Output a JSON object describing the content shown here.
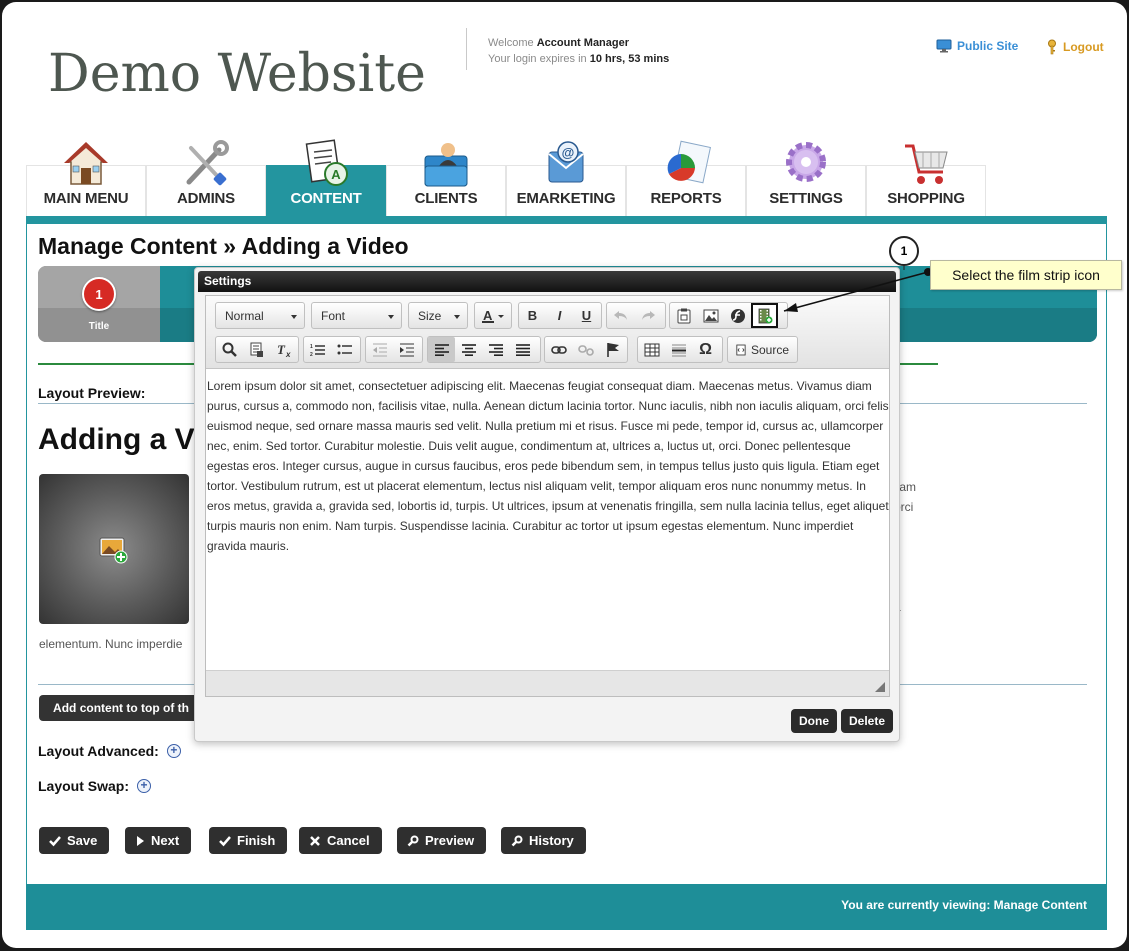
{
  "header": {
    "site_title": "Demo Website",
    "welcome_prefix": "Welcome",
    "user_name": "Account Manager",
    "login_prefix": "Your login expires in",
    "login_time": "10 hrs, 53 mins",
    "public_site": "Public Site",
    "logout": "Logout"
  },
  "nav": {
    "items": [
      {
        "label": "MAIN MENU",
        "icon": "house-icon"
      },
      {
        "label": "ADMINS",
        "icon": "tools-icon"
      },
      {
        "label": "CONTENT",
        "icon": "document-edit-icon",
        "active": true
      },
      {
        "label": "CLIENTS",
        "icon": "client-folder-icon"
      },
      {
        "label": "EMARKETING",
        "icon": "email-icon"
      },
      {
        "label": "REPORTS",
        "icon": "report-chart-icon"
      },
      {
        "label": "SETTINGS",
        "icon": "gear-icon"
      },
      {
        "label": "SHOPPING",
        "icon": "shopping-cart-icon"
      }
    ]
  },
  "page": {
    "heading": "Manage Content » Adding a Video",
    "step_number": "1",
    "step_label": "Title",
    "layout_preview_label": "Layout Preview:",
    "preview_title": "Adding a V",
    "preview_snippet": "elementum. Nunc imperdie",
    "right_fragments": [
      "liam",
      "orci",
      "",
      "",
      "s",
      "t",
      "a"
    ],
    "add_top_label": "Add content to top of th",
    "layout_advanced": "Layout Advanced:",
    "layout_swap": "Layout Swap:"
  },
  "actions": {
    "save": "Save",
    "next": "Next",
    "finish": "Finish",
    "cancel": "Cancel",
    "preview": "Preview",
    "history": "History"
  },
  "footer": {
    "viewing": "You are currently viewing: Manage Content"
  },
  "dialog": {
    "title": "Settings",
    "format_combo": "Normal",
    "font_combo": "Font",
    "size_combo": "Size",
    "source_label": "Source",
    "body_text": "Lorem ipsum dolor sit amet, consectetuer adipiscing elit. Maecenas feugiat consequat diam. Maecenas metus. Vivamus diam purus, cursus a, commodo non, facilisis vitae, nulla. Aenean dictum lacinia tortor. Nunc iaculis, nibh non iaculis aliquam, orci felis euismod neque, sed ornare massa mauris sed velit. Nulla pretium mi et risus. Fusce mi pede, tempor id, cursus ac, ullamcorper nec, enim. Sed tortor. Curabitur molestie. Duis velit augue, condimentum at, ultrices a, luctus ut, orci. Donec pellentesque egestas eros. Integer cursus, augue in cursus faucibus, eros pede bibendum sem, in tempus tellus justo quis ligula. Etiam eget tortor. Vestibulum rutrum, est ut placerat elementum, lectus nisl aliquam velit, tempor aliquam eros nunc nonummy metus. In eros metus, gravida a, gravida sed, lobortis id, turpis. Ut ultrices, ipsum at venenatis fringilla, sem nulla lacinia tellus, eget aliquet turpis mauris non enim. Nam turpis. Suspendisse lacinia. Curabitur ac tortor ut ipsum egestas elementum. Nunc imperdiet gravida mauris.",
    "done": "Done",
    "delete": "Delete"
  },
  "callout": {
    "number": "1",
    "text": "Select the film strip icon"
  },
  "colors": {
    "teal": "#23959f",
    "footer_teal": "#1e8e98",
    "step_red": "#d62a24",
    "callout_yellow": "#ffffcc"
  }
}
